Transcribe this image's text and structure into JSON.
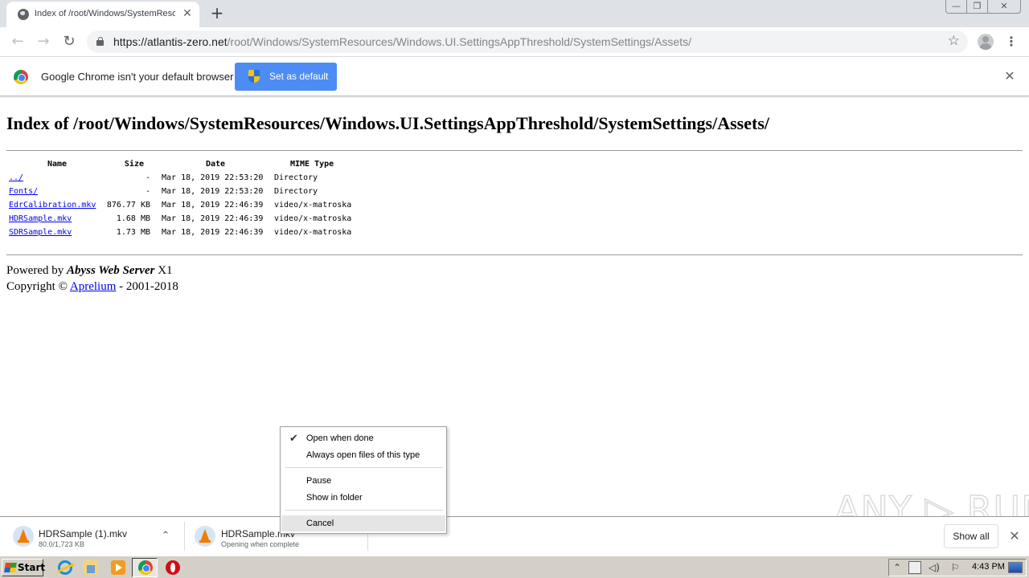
{
  "browser": {
    "tab": {
      "title": "Index of /root/Windows/SystemResources/Windows.UI.SettingsAppThreshold/SystemSettings/Assets/",
      "favicon": "globe-icon",
      "close": "✕"
    },
    "new_tab": "+",
    "window_controls": {
      "minimize": "—",
      "restore": "❐",
      "close": "✕"
    },
    "nav": {
      "back": "←",
      "forward": "→",
      "reload": "↻"
    },
    "url": {
      "host": "https://atlantis-zero.net",
      "path": "/root/Windows/SystemResources/Windows.UI.SettingsAppThreshold/SystemSettings/Assets/"
    },
    "bookmark": "☆",
    "menu": "⋮"
  },
  "infobar": {
    "message": "Google Chrome isn't your default browser",
    "button": "Set as default",
    "close": "✕"
  },
  "page": {
    "heading": "Index of /root/Windows/SystemResources/Windows.UI.SettingsAppThreshold/SystemSettings/Assets/",
    "columns": {
      "name": "Name",
      "size": "Size",
      "date": "Date",
      "mime": "MIME Type"
    },
    "rows": [
      {
        "name": "../",
        "size": "-",
        "date": "Mar 18, 2019 22:53:20",
        "mime": "Directory"
      },
      {
        "name": "Fonts/",
        "size": "-",
        "date": "Mar 18, 2019 22:53:20",
        "mime": "Directory"
      },
      {
        "name": "EdrCalibration.mkv",
        "size": "876.77 KB",
        "date": "Mar 18, 2019 22:46:39",
        "mime": "video/x-matroska"
      },
      {
        "name": "HDRSample.mkv",
        "size": "1.68 MB",
        "date": "Mar 18, 2019 22:46:39",
        "mime": "video/x-matroska"
      },
      {
        "name": "SDRSample.mkv",
        "size": "1.73 MB",
        "date": "Mar 18, 2019 22:46:39",
        "mime": "video/x-matroska"
      }
    ],
    "footer": {
      "powered_prefix": "Powered by ",
      "server": "Abyss Web Server",
      "server_suffix": " X1",
      "copyright_prefix": "Copyright © ",
      "company": "Aprelium",
      "copyright_suffix": " - 2001-2018"
    }
  },
  "context_menu": {
    "items": [
      {
        "label": "Open when done",
        "checked": true
      },
      {
        "label": "Always open files of this type"
      },
      {
        "label": "Pause"
      },
      {
        "label": "Show in folder"
      },
      {
        "label": "Cancel",
        "highlighted": true
      }
    ],
    "check": "✔"
  },
  "downloads": {
    "items": [
      {
        "name": "HDRSample (1).mkv",
        "status": "80.0/1,723 KB"
      },
      {
        "name": "HDRSample.mkv",
        "status": "Opening when complete"
      }
    ],
    "chevron": "⌃",
    "show_all": "Show all",
    "close": "✕"
  },
  "watermark": "ANY ▷ RUN",
  "taskbar": {
    "start": "Start",
    "tray": {
      "expand": "⌃",
      "clock": "4:43 PM"
    }
  }
}
